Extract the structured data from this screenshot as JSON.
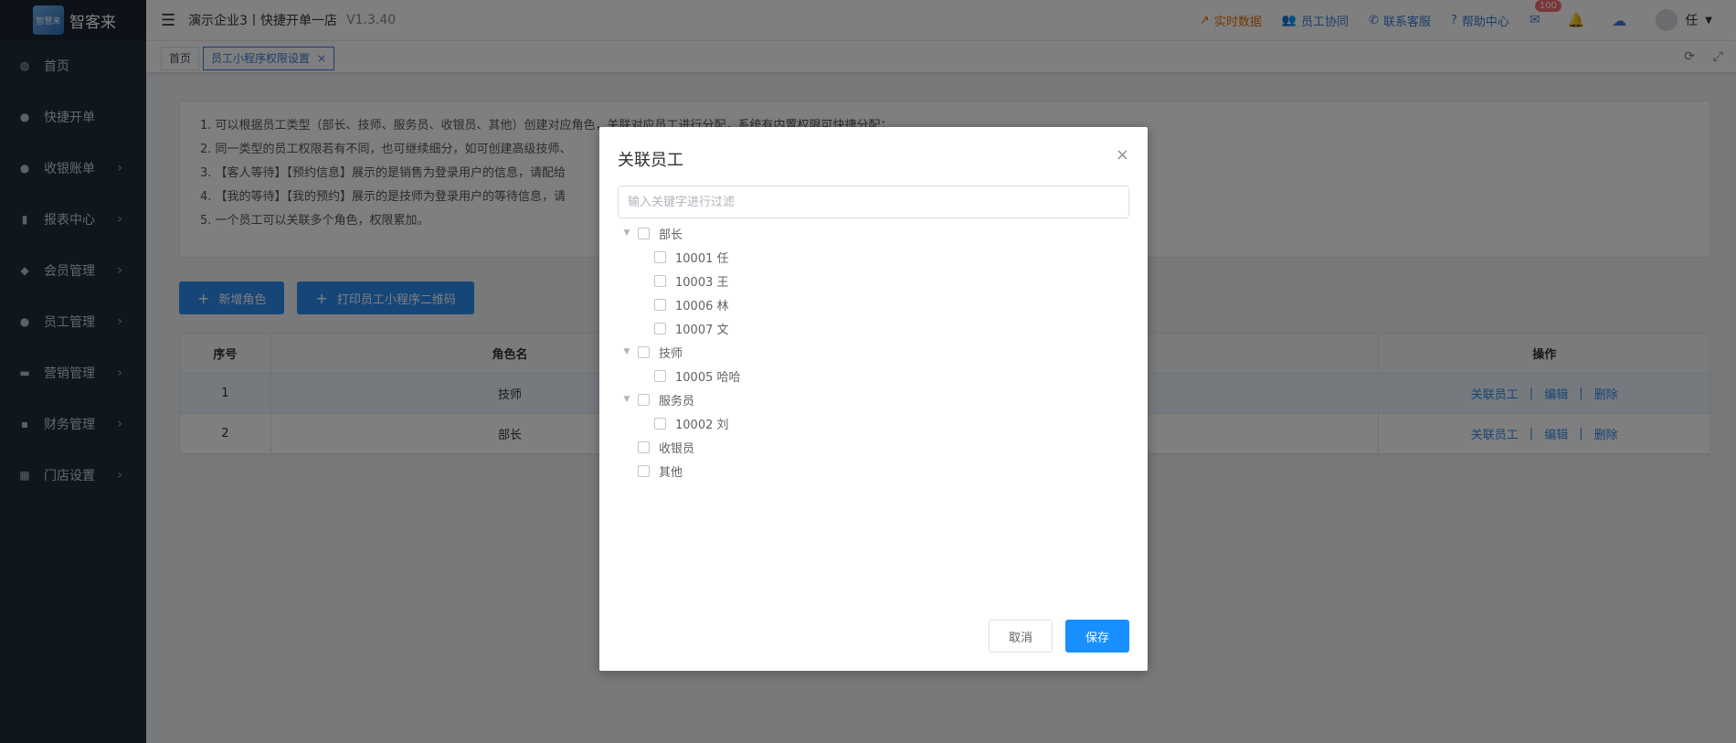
{
  "sidebar": {
    "logo_badge": "智慧来",
    "logo_text": "智客来",
    "items": [
      {
        "label": "首页",
        "icon": "dashboard-icon",
        "chevron": false
      },
      {
        "label": "快捷开单",
        "icon": "bag-icon",
        "chevron": false
      },
      {
        "label": "收银账单",
        "icon": "bag-icon",
        "chevron": true
      },
      {
        "label": "报表中心",
        "icon": "bar-chart-icon",
        "chevron": true
      },
      {
        "label": "会员管理",
        "icon": "diamond-icon",
        "chevron": true
      },
      {
        "label": "员工管理",
        "icon": "user-icon",
        "chevron": true
      },
      {
        "label": "营销管理",
        "icon": "briefcase-icon",
        "chevron": true
      },
      {
        "label": "财务管理",
        "icon": "wallet-icon",
        "chevron": true
      },
      {
        "label": "门店设置",
        "icon": "grid-icon",
        "chevron": true
      }
    ]
  },
  "header": {
    "company": "演示企业3丨快捷开单一店",
    "version": "V1.3.40",
    "links": {
      "realtime": "实时数据",
      "staff_collab": "员工协同",
      "contact_service": "联系客服",
      "help_center": "帮助中心"
    },
    "mail_badge": "100",
    "username": "任"
  },
  "tabs": {
    "home": "首页",
    "active": "员工小程序权限设置",
    "close": "×"
  },
  "notice": {
    "lines": [
      "1. 可以根据员工类型（部长、技师、服务员、收银员、其他）创建对应角色，关联对应员工进行分配，系统有内置权限可快捷分配；",
      "2. 同一类型的员工权限若有不同，也可继续细分，如可创建高级技师、",
      "3. 【客人等待】【预约信息】展示的是销售为登录用户的信息，请配给",
      "4. 【我的等待】【我的预约】展示的是技师为登录用户的等待信息，请",
      "5. 一个员工可以关联多个角色，权限累加。"
    ]
  },
  "buttons": {
    "add_role": "新增角色",
    "print_qr": "打印员工小程序二维码"
  },
  "table": {
    "headers": [
      "序号",
      "角色名",
      "",
      "操作"
    ],
    "rows": [
      {
        "no": "1",
        "name": "技师"
      },
      {
        "no": "2",
        "name": "部长"
      }
    ],
    "ops": {
      "link_staff": "关联员工",
      "edit": "编辑",
      "delete": "删除",
      "separator": "|"
    }
  },
  "modal": {
    "title": "关联员工",
    "close": "×",
    "filter_placeholder": "输入关键字进行过滤",
    "tree": [
      {
        "label": "部长",
        "children": [
          "10001 任",
          "10003 王",
          "10006 林",
          "10007 文"
        ]
      },
      {
        "label": "技师",
        "children": [
          "10005 哈哈"
        ]
      },
      {
        "label": "服务员",
        "children": [
          "10002 刘"
        ]
      },
      {
        "label": "收银员",
        "children": []
      },
      {
        "label": "其他",
        "children": []
      }
    ],
    "cancel": "取消",
    "save": "保存"
  },
  "colors": {
    "sidebar_bg": "#1f2d3d",
    "primary": "#2d8cf0",
    "accent_orange": "#e8710a",
    "badge_red": "#f56c6c"
  }
}
